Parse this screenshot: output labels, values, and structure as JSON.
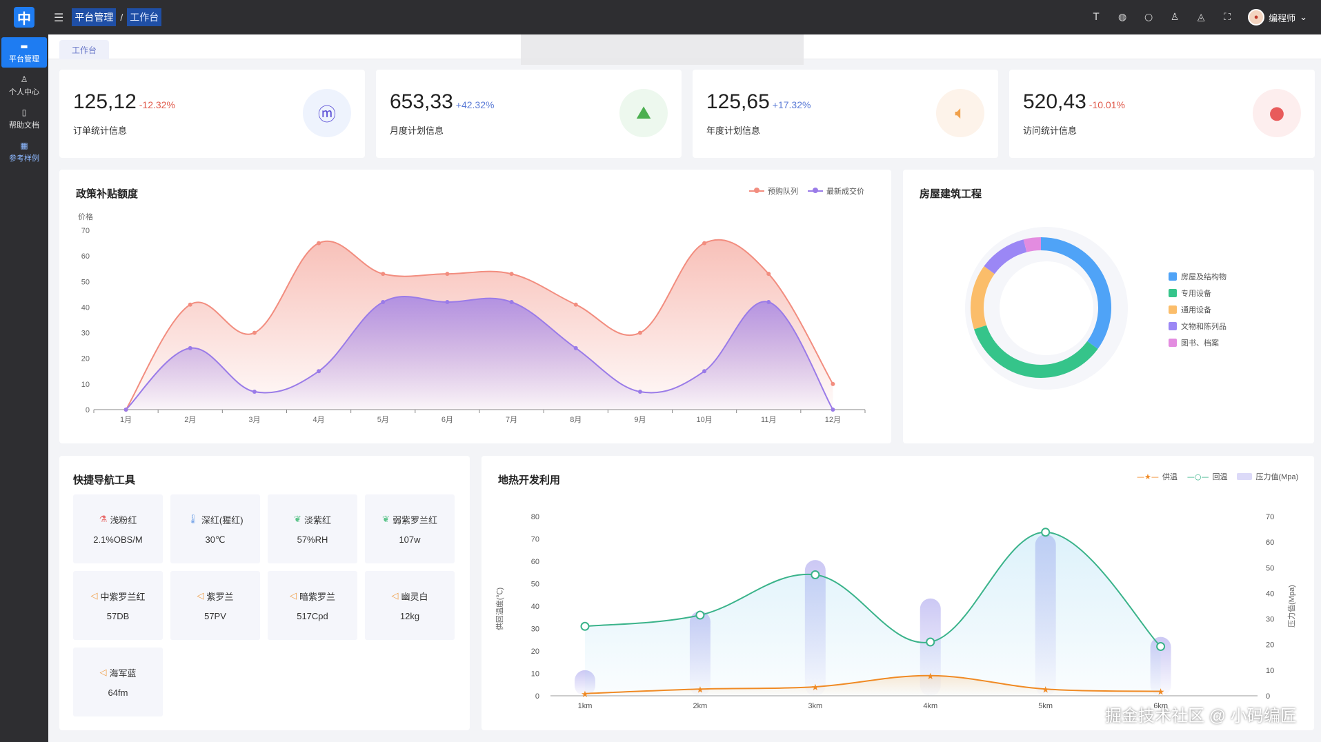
{
  "topbar": {
    "logo": "中",
    "breadcrumb": [
      "平台管理",
      "工作台"
    ],
    "user_name": "编程师",
    "icons": [
      "font-size-icon",
      "globe-icon",
      "search-icon",
      "shirt-icon",
      "bell-icon",
      "fullscreen-icon"
    ]
  },
  "sidebar": {
    "items": [
      {
        "label": "平台管理",
        "icon": "monitor-icon"
      },
      {
        "label": "个人中心",
        "icon": "user-icon"
      },
      {
        "label": "帮助文档",
        "icon": "doc-icon"
      },
      {
        "label": "参考样例",
        "icon": "grid-icon"
      }
    ]
  },
  "tabs": {
    "active": "工作台"
  },
  "toast": "",
  "stats": [
    {
      "value": "125,12",
      "pct": "-12.32%",
      "label": "订单统计信息",
      "icon": "meituan-icon",
      "color": "#5b4fd6",
      "bg": "#eef3fd"
    },
    {
      "value": "653,33",
      "pct": "+42.32%",
      "label": "月度计划信息",
      "icon": "map-icon",
      "color": "#4caf50",
      "bg": "#edf8ee"
    },
    {
      "value": "125,65",
      "pct": "+17.32%",
      "label": "年度计划信息",
      "icon": "speaker-icon",
      "color": "#f0a04b",
      "bg": "#fdf3ea"
    },
    {
      "value": "520,43",
      "pct": "-10.01%",
      "label": "访问统计信息",
      "icon": "github-icon",
      "color": "#e85b5b",
      "bg": "#fdeeee"
    }
  ],
  "policy_chart": {
    "title": "政策补贴额度",
    "chart_data": {
      "type": "area",
      "categories": [
        "1月",
        "2月",
        "3月",
        "4月",
        "5月",
        "6月",
        "7月",
        "8月",
        "9月",
        "10月",
        "11月",
        "12月"
      ],
      "series": [
        {
          "name": "预购队列",
          "color": "#f28d7f",
          "values": [
            0,
            41,
            30,
            65,
            53,
            53,
            53,
            41,
            30,
            65,
            53,
            10
          ]
        },
        {
          "name": "最新成交价",
          "color": "#9a7be8",
          "values": [
            0,
            24,
            7,
            15,
            42,
            42,
            42,
            24,
            7,
            15,
            42,
            0
          ]
        }
      ],
      "ylabel": "价格",
      "ylim": [
        0,
        70
      ],
      "yticks": [
        0,
        10,
        20,
        30,
        40,
        50,
        60,
        70
      ]
    }
  },
  "donut_chart": {
    "title": "房屋建筑工程",
    "chart_data": {
      "type": "pie",
      "labels": [
        "房屋及结构物",
        "专用设备",
        "通用设备",
        "文物和陈列品",
        "图书、档案"
      ],
      "values": [
        35,
        35,
        15,
        11,
        4
      ],
      "colors": [
        "#4fa3f7",
        "#35c48a",
        "#fbbd6a",
        "#9b87f5",
        "#e38ce0"
      ]
    }
  },
  "quick_nav": {
    "title": "快捷导航工具",
    "tiles": [
      {
        "name": "浅粉红",
        "value": "2.1%OBS/M",
        "icon": "flask-icon",
        "color": "#e86d6d"
      },
      {
        "name": "深红(猩红)",
        "value": "30℃",
        "icon": "thermometer-icon",
        "color": "#7aa7e8"
      },
      {
        "name": "淡紫红",
        "value": "57%RH",
        "icon": "leaf-icon",
        "color": "#5cc48a"
      },
      {
        "name": "弱紫罗兰红",
        "value": "107w",
        "icon": "leaf-icon",
        "color": "#5cc48a"
      },
      {
        "name": "中紫罗兰红",
        "value": "57DB",
        "icon": "speaker-icon",
        "color": "#f0a04b"
      },
      {
        "name": "紫罗兰",
        "value": "57PV",
        "icon": "speaker-icon",
        "color": "#f0a04b"
      },
      {
        "name": "暗紫罗兰",
        "value": "517Cpd",
        "icon": "speaker-icon",
        "color": "#f0a04b"
      },
      {
        "name": "幽灵白",
        "value": "12kg",
        "icon": "speaker-icon",
        "color": "#f0a04b"
      },
      {
        "name": "海军蓝",
        "value": "64fm",
        "icon": "speaker-icon",
        "color": "#f0a04b"
      }
    ]
  },
  "geo_chart": {
    "title": "地热开发利用",
    "chart_data": {
      "type": "line",
      "categories": [
        "1km",
        "2km",
        "3km",
        "4km",
        "5km",
        "6km"
      ],
      "series": [
        {
          "name": "供温",
          "color": "#f08a24",
          "axis": "left",
          "values": [
            1,
            3,
            4,
            9,
            3,
            2
          ]
        },
        {
          "name": "回温",
          "color": "#3ab38a",
          "axis": "left",
          "values": [
            31,
            36,
            54,
            24,
            73,
            22
          ]
        },
        {
          "name": "压力值(Mpa)",
          "color": "#c6c2f3",
          "axis": "right",
          "type": "bar",
          "values": [
            10,
            33,
            53,
            38,
            63,
            23
          ]
        }
      ],
      "ylabel_left": "供回温度(℃)",
      "ylabel_right": "压力值(Mpa)",
      "ylim_left": [
        0,
        80
      ],
      "yticks_left": [
        0,
        10,
        20,
        30,
        40,
        50,
        60,
        70,
        80
      ],
      "ylim_right": [
        0,
        70
      ],
      "yticks_right": [
        0,
        10,
        20,
        30,
        40,
        50,
        60,
        70
      ]
    }
  },
  "watermark": "掘金技术社区 @ 小码编匠"
}
